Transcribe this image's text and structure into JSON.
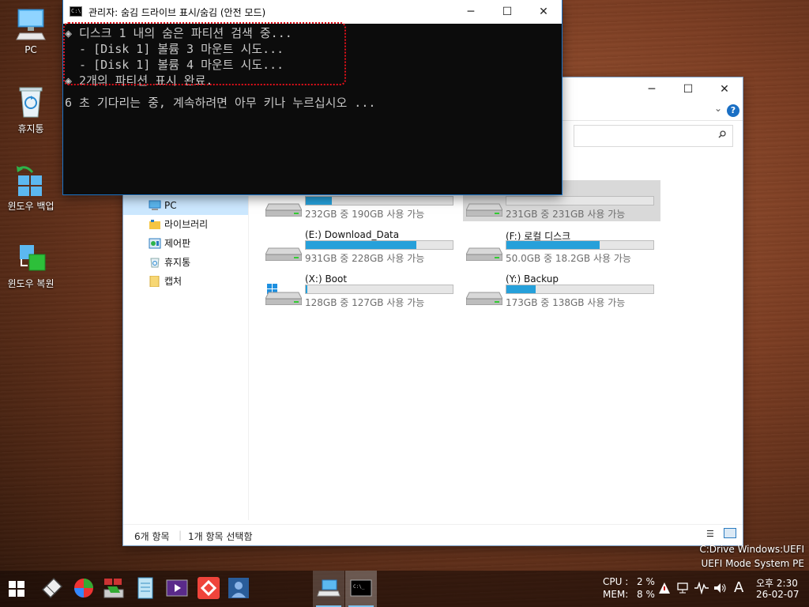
{
  "desktop": {
    "icons": [
      {
        "label": "PC",
        "icon": "pc-icon"
      },
      {
        "label": "휴지통",
        "icon": "recycle-bin-icon"
      },
      {
        "label": "윈도우 백업",
        "icon": "windows-backup-icon"
      },
      {
        "label": "윈도우 복원",
        "icon": "windows-restore-icon"
      }
    ],
    "overlay_line1": "C:Drive Windows:UEFI",
    "overlay_line2": "UEFI Mode System PE"
  },
  "console": {
    "title": "관리자: 숨김 드라이브 표시/숨김 (안전 모드)",
    "lines": [
      "◈ 디스크 1 내의 숨은 파티션 검색 중...",
      "  - [Disk 1] 볼륨 3 마운트 시도...",
      "  - [Disk 1] 볼륨 4 마운트 시도...",
      "◈ 2개의 파티션 표시 완료.",
      "",
      "6 초 기다리는 중, 계속하려면 아무 키나 누르십시오 ..."
    ]
  },
  "explorer": {
    "help": "?",
    "nav": [
      {
        "label": "PC",
        "icon": "pc-icon",
        "selected": true
      },
      {
        "label": "라이브러리",
        "icon": "library-icon",
        "selected": false
      },
      {
        "label": "제어판",
        "icon": "control-panel-icon",
        "selected": false
      },
      {
        "label": "휴지통",
        "icon": "recycle-bin-icon",
        "selected": false
      },
      {
        "label": "캡처",
        "icon": "folder-icon",
        "selected": false
      }
    ],
    "drives": [
      {
        "name": "",
        "size": "232GB 중 190GB 사용 가능",
        "used_fraction": 0.18,
        "selected": false
      },
      {
        "name": "",
        "size": "231GB 중 231GB 사용 가능",
        "used_fraction": 0.0,
        "selected": true
      },
      {
        "name": "(E:) Download_Data",
        "size": "931GB 중 228GB 사용 가능",
        "used_fraction": 0.755,
        "selected": false
      },
      {
        "name": "(F:) 로컬 디스크",
        "size": "50.0GB 중 18.2GB 사용 가능",
        "used_fraction": 0.636,
        "selected": false
      },
      {
        "name": "(X:) Boot",
        "size": "128GB 중 127GB 사용 가능",
        "used_fraction": 0.01,
        "selected": false
      },
      {
        "name": "(Y:) Backup",
        "size": "173GB 중 138GB 사용 가능",
        "used_fraction": 0.2,
        "selected": false
      }
    ],
    "status_count": "6개 항목",
    "status_selected": "1개 항목 선택함"
  },
  "taskbar": {
    "cpu_label": "CPU :",
    "cpu_value": "2 %",
    "mem_label": "MEM:",
    "mem_value": "8 %",
    "ime": "A",
    "time": "오후 2:30",
    "date": "26-02-07"
  }
}
